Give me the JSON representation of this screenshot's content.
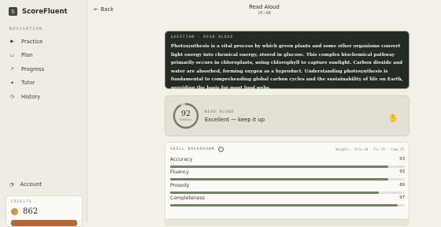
{
  "app": {
    "name": "ScoreFluent",
    "logo_glyph": "S"
  },
  "sidebar": {
    "section_label": "NAVIGATION",
    "items": [
      {
        "label": "Practice",
        "icon": "play-icon",
        "glyph": "▶"
      },
      {
        "label": "Plan",
        "icon": "calendar-icon",
        "glyph": "▭"
      },
      {
        "label": "Progress",
        "icon": "chart-icon",
        "glyph": "↗"
      },
      {
        "label": "Tutor",
        "icon": "sparkle-icon",
        "glyph": "✦"
      },
      {
        "label": "History",
        "icon": "clock-icon",
        "glyph": "◷"
      }
    ],
    "account": {
      "label": "Account",
      "icon": "user-icon",
      "glyph": "◔"
    }
  },
  "credits": {
    "label": "CREDITS",
    "value": "862"
  },
  "header": {
    "back_label": "Back",
    "back_glyph": "←",
    "title": "Read Aloud",
    "timer": "15:48"
  },
  "passage": {
    "label": "QUESTION · READ ALOUD",
    "text": "Photosynthesis is a vital process by which green plants and some other organisms convert light energy into chemical energy, stored in glucose. This complex biochemical pathway primarily occurs in chloroplasts, using chlorophyll to capture sunlight. Carbon dioxide and water are absorbed, forming oxygen as a byproduct. Understanding photosynthesis is fundamental to comprehending global carbon cycles and the sustainability of life on Earth, providing the basis for most food webs."
  },
  "result": {
    "score": "92",
    "score_fraction": 0.92,
    "score_sub": "OVERALL",
    "label": "READ ALOUD",
    "message": "Excellent — keep it up",
    "mascot_glyph": "✋"
  },
  "breakdown": {
    "title": "SKILL BREAKDOWN",
    "weights": "Weights · Pron 40 · Flu 35 · Comp 25",
    "metrics": [
      {
        "name": "Accuracy",
        "value": "93",
        "fraction": 0.93
      },
      {
        "name": "Fluency",
        "value": "93",
        "fraction": 0.93
      },
      {
        "name": "Prosody",
        "value": "89",
        "fraction": 0.89
      },
      {
        "name": "Completeness",
        "value": "97",
        "fraction": 0.97
      }
    ]
  },
  "colors": {
    "accent": "#6f8067",
    "ring_track": "#cfc9bc",
    "credits_button": "#b5673a",
    "passage_bg": "#242a24"
  }
}
